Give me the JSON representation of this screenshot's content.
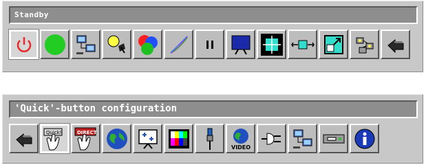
{
  "top_panel": {
    "status_text": "Standby",
    "buttons": [
      {
        "icon": "power-icon",
        "color": "#e8282a"
      },
      {
        "icon": "green-circle-icon",
        "color": "#22cc22"
      },
      {
        "icon": "computer-network-icon"
      },
      {
        "icon": "lamp-icon"
      },
      {
        "icon": "rgb-color-icon"
      },
      {
        "icon": "curve-icon"
      },
      {
        "icon": "pause-icon"
      },
      {
        "icon": "screen-icon"
      },
      {
        "icon": "resize-frame-icon"
      },
      {
        "icon": "horizontal-arrows-icon"
      },
      {
        "icon": "window-expand-icon"
      },
      {
        "icon": "network-hub-icon"
      },
      {
        "icon": "back-arrow-icon"
      }
    ]
  },
  "bottom_panel": {
    "status_text": "'Quick'-button configuration",
    "buttons": [
      {
        "icon": "back-arrow-icon"
      },
      {
        "icon": "quick-hand-icon",
        "label": "Quick!"
      },
      {
        "icon": "direct-hand-icon",
        "label": "DIRECT"
      },
      {
        "icon": "globe-icon"
      },
      {
        "icon": "presentation-board-icon"
      },
      {
        "icon": "test-pattern-icon"
      },
      {
        "icon": "cable-plug-icon"
      },
      {
        "icon": "video-globe-icon",
        "label": "VIDEO"
      },
      {
        "icon": "power-plug-icon"
      },
      {
        "icon": "computer-network-icon"
      },
      {
        "icon": "device-box-icon"
      },
      {
        "icon": "info-icon"
      }
    ]
  }
}
